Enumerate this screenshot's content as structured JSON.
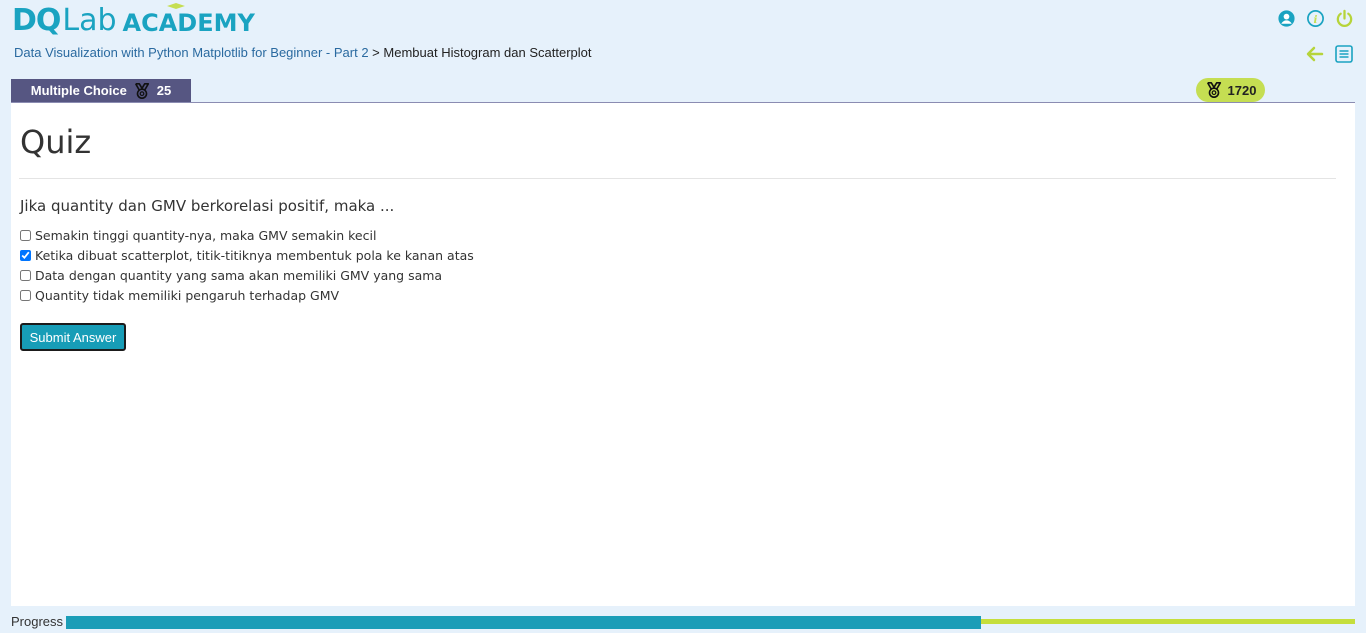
{
  "logo": {
    "part1": "DQ",
    "part2": "Lab",
    "part3": "ACADEMY"
  },
  "header_icons": [
    "user-icon",
    "info-icon",
    "power-icon"
  ],
  "breadcrumb": {
    "link": "Data Visualization with Python Matplotlib for Beginner - Part 2",
    "separator": " > ",
    "current": "Membuat Histogram dan Scatterplot"
  },
  "nav_icons": [
    "back-arrow-icon",
    "list-icon"
  ],
  "tab": {
    "label": "Multiple Choice",
    "points": "25"
  },
  "total_points": "1720",
  "quiz": {
    "title": "Quiz",
    "question": "Jika quantity dan GMV berkorelasi positif, maka ...",
    "options": [
      {
        "label": "Semakin tinggi quantity-nya, maka GMV semakin kecil",
        "checked": false
      },
      {
        "label": "Ketika dibuat scatterplot, titik-titiknya membentuk pola ke kanan atas",
        "checked": true
      },
      {
        "label": "Data dengan quantity yang sama akan memiliki GMV yang sama",
        "checked": false
      },
      {
        "label": "Quantity tidak memiliki pengaruh terhadap GMV",
        "checked": false
      }
    ],
    "submit_label": "Submit Answer"
  },
  "progress": {
    "label": "Progress",
    "fraction": 0.71
  },
  "colors": {
    "accent": "#1aa3c1",
    "lime": "#c5de52",
    "tab": "#565682"
  }
}
